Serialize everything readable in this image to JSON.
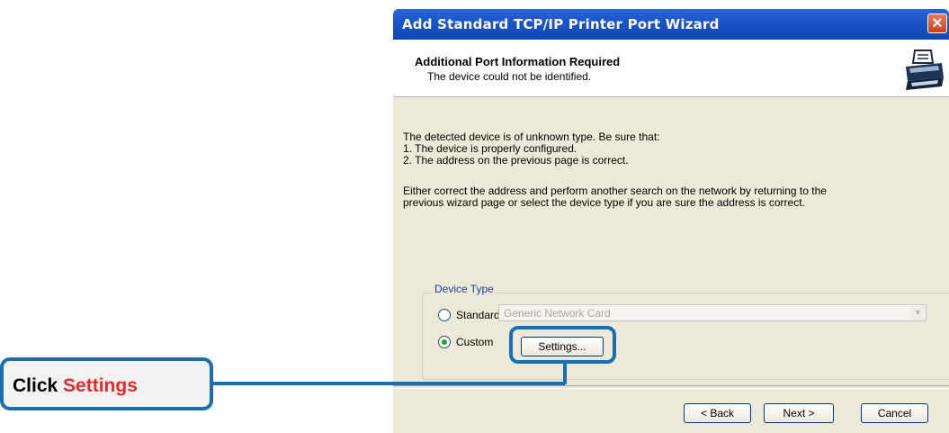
{
  "window": {
    "title": "Add Standard TCP/IP Printer Port Wizard",
    "close_label": "✕"
  },
  "header": {
    "title": "Additional Port Information Required",
    "subtitle": "The device could not be identified."
  },
  "body": {
    "lines": [
      "The detected device is of unknown type.  Be sure that:",
      "1. The device is properly configured.",
      "2.  The address on the previous page is correct.",
      "Either correct the address and perform another search on the network by returning to the",
      "previous wizard page or select the device type if you are sure the address is correct."
    ]
  },
  "device_type": {
    "label": "Device Type",
    "standard_label": "Standard",
    "custom_label": "Custom",
    "selected": "Custom",
    "standard_select_value": "Generic Network Card",
    "settings_button": "Settings..."
  },
  "footer": {
    "back_button": "< Back",
    "next_button": "Next >",
    "cancel_button": "Cancel"
  },
  "callout": {
    "prefix": "Click",
    "accent": "Settings",
    "accent_color": "#e52a28",
    "border_color": "#1a6fb0"
  },
  "icons": {
    "header_icon": "printer-icon",
    "select_arrow": "chevron-down-icon"
  }
}
